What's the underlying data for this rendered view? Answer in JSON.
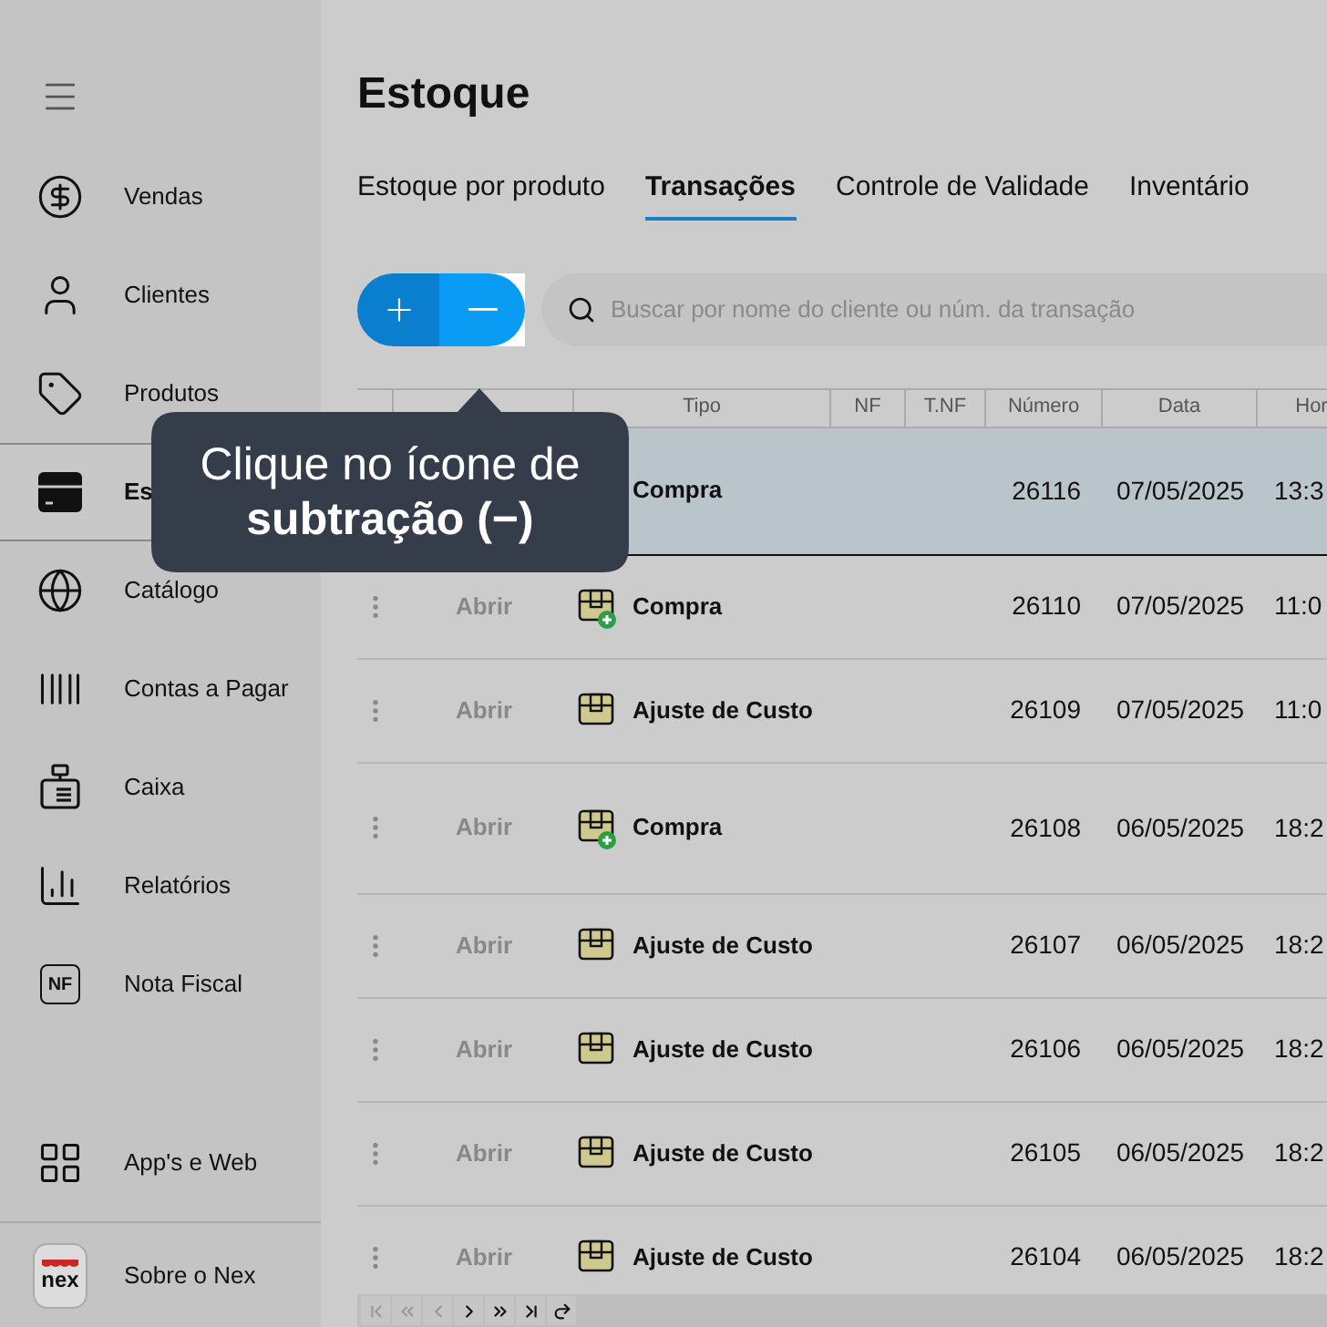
{
  "sidebar": {
    "items": [
      {
        "label": "Vendas",
        "selected": false
      },
      {
        "label": "Clientes",
        "selected": false
      },
      {
        "label": "Produtos",
        "selected": false
      },
      {
        "label": "Es",
        "selected": true
      },
      {
        "label": "Catálogo",
        "selected": false
      },
      {
        "label": "Contas a Pagar",
        "selected": false
      },
      {
        "label": "Caixa",
        "selected": false
      },
      {
        "label": "Relatórios",
        "selected": false
      },
      {
        "icon_text": "NF",
        "label": "Nota Fiscal",
        "selected": false
      }
    ],
    "bottom_items": [
      {
        "label": "App's e Web"
      },
      {
        "icon_text": "nex",
        "label": "Sobre o Nex"
      }
    ]
  },
  "page_title": "Estoque",
  "tabs": [
    {
      "label": "Estoque por produto",
      "selected": false
    },
    {
      "label": "Transações",
      "selected": true
    },
    {
      "label": "Controle de Validade",
      "selected": false
    },
    {
      "label": "Inventário",
      "selected": false
    }
  ],
  "search": {
    "placeholder": "Buscar por nome do cliente ou núm. da transação"
  },
  "table": {
    "columns": [
      "Tipo",
      "NF",
      "T.NF",
      "Número",
      "Data",
      "Hor"
    ],
    "rows": [
      {
        "selected": true,
        "type": "Compra",
        "number": "26116",
        "date": "07/05/2025",
        "time": "13:3"
      },
      {
        "selected": false,
        "action": "Abrir",
        "kind": "purchase",
        "type": "Compra",
        "number": "26110",
        "date": "07/05/2025",
        "time": "11:0"
      },
      {
        "selected": false,
        "action": "Abrir",
        "kind": "adjust",
        "type": "Ajuste de Custo",
        "number": "26109",
        "date": "07/05/2025",
        "time": "11:0"
      },
      {
        "selected": false,
        "action": "Abrir",
        "kind": "purchase",
        "type": "Compra",
        "number": "26108",
        "date": "06/05/2025",
        "time": "18:2"
      },
      {
        "selected": false,
        "action": "Abrir",
        "kind": "adjust",
        "type": "Ajuste de Custo",
        "number": "26107",
        "date": "06/05/2025",
        "time": "18:2"
      },
      {
        "selected": false,
        "action": "Abrir",
        "kind": "adjust",
        "type": "Ajuste de Custo",
        "number": "26106",
        "date": "06/05/2025",
        "time": "18:2"
      },
      {
        "selected": false,
        "action": "Abrir",
        "kind": "adjust",
        "type": "Ajuste de Custo",
        "number": "26105",
        "date": "06/05/2025",
        "time": "18:2"
      },
      {
        "selected": false,
        "action": "Abrir",
        "kind": "adjust",
        "type": "Ajuste de Custo",
        "number": "26104",
        "date": "06/05/2025",
        "time": "18:2"
      }
    ]
  },
  "pager": [
    {
      "kind": "first",
      "disabled": true
    },
    {
      "kind": "prev_page",
      "disabled": true
    },
    {
      "kind": "prev",
      "disabled": true
    },
    {
      "kind": "next",
      "disabled": false
    },
    {
      "kind": "next_page",
      "disabled": false
    },
    {
      "kind": "last",
      "disabled": false
    },
    {
      "kind": "refresh",
      "disabled": false
    }
  ],
  "tooltip": {
    "text": "Clique no ícone de **subtração (−)**"
  }
}
